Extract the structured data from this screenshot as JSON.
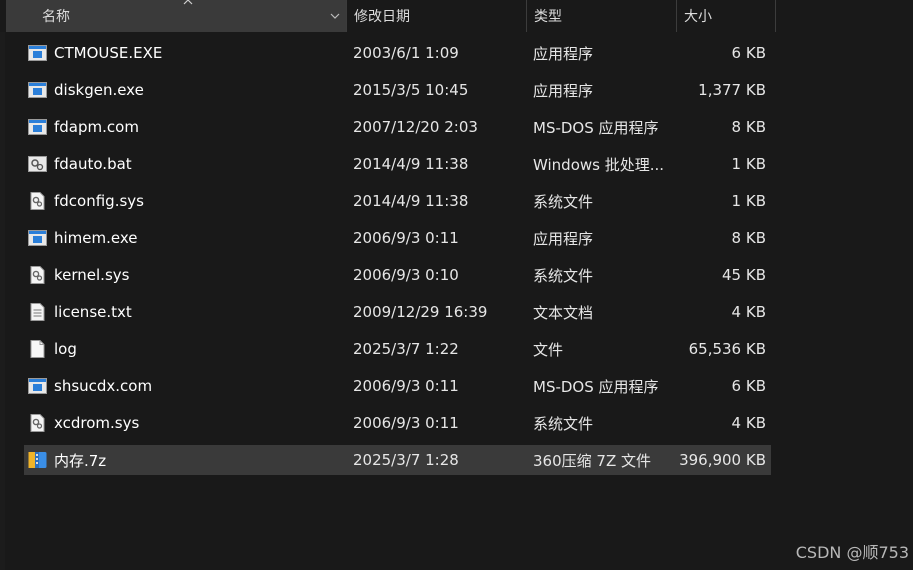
{
  "header": {
    "name_label": "名称",
    "date_label": "修改日期",
    "type_label": "类型",
    "size_label": "大小"
  },
  "files": [
    {
      "name": "CTMOUSE.EXE",
      "date": "2003/6/1 1:09",
      "type": "应用程序",
      "size": "6 KB",
      "icon": "exe-icon"
    },
    {
      "name": "diskgen.exe",
      "date": "2015/3/5 10:45",
      "type": "应用程序",
      "size": "1,377 KB",
      "icon": "exe-icon"
    },
    {
      "name": "fdapm.com",
      "date": "2007/12/20 2:03",
      "type": "MS-DOS 应用程序",
      "size": "8 KB",
      "icon": "exe-icon"
    },
    {
      "name": "fdauto.bat",
      "date": "2014/4/9 11:38",
      "type": "Windows 批处理...",
      "size": "1 KB",
      "icon": "bat-icon"
    },
    {
      "name": "fdconfig.sys",
      "date": "2014/4/9 11:38",
      "type": "系统文件",
      "size": "1 KB",
      "icon": "sys-file-icon"
    },
    {
      "name": "himem.exe",
      "date": "2006/9/3 0:11",
      "type": "应用程序",
      "size": "8 KB",
      "icon": "exe-icon"
    },
    {
      "name": "kernel.sys",
      "date": "2006/9/3 0:10",
      "type": "系统文件",
      "size": "45 KB",
      "icon": "sys-file-icon"
    },
    {
      "name": "license.txt",
      "date": "2009/12/29 16:39",
      "type": "文本文档",
      "size": "4 KB",
      "icon": "text-file-icon"
    },
    {
      "name": "log",
      "date": "2025/3/7 1:22",
      "type": "文件",
      "size": "65,536 KB",
      "icon": "blank-file-icon"
    },
    {
      "name": "shsucdx.com",
      "date": "2006/9/3 0:11",
      "type": "MS-DOS 应用程序",
      "size": "6 KB",
      "icon": "exe-icon"
    },
    {
      "name": "xcdrom.sys",
      "date": "2006/9/3 0:11",
      "type": "系统文件",
      "size": "4 KB",
      "icon": "sys-file-icon"
    },
    {
      "name": "内存.7z",
      "date": "2025/3/7 1:28",
      "type": "360压缩 7Z 文件",
      "size": "396,900 KB",
      "icon": "archive-icon",
      "selected": true
    }
  ],
  "watermark": "CSDN @顺753",
  "colors": {
    "background": "#191919",
    "header_active": "#3a3a3a",
    "selected_row": "#3a3a3a",
    "text": "#ffffff",
    "exe_icon_blue": "#2b7fd9",
    "archive_icon_blue": "#3a8ee6",
    "archive_icon_yellow": "#f0b429"
  }
}
